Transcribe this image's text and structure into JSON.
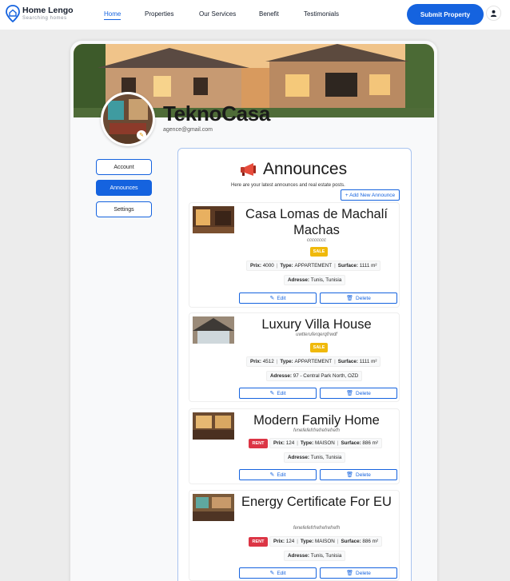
{
  "brand": {
    "name": "Home Lengo",
    "tagline": "Searching homes"
  },
  "nav": {
    "links": [
      {
        "label": "Home",
        "active": true
      },
      {
        "label": "Properties"
      },
      {
        "label": "Our Services"
      },
      {
        "label": "Benefit"
      },
      {
        "label": "Testimonials"
      }
    ],
    "submit_label": "Submit Property"
  },
  "profile": {
    "name": "TeknoCasa",
    "email": "agence@gmail.com"
  },
  "sidebar": {
    "items": [
      {
        "label": "Account"
      },
      {
        "label": "Announces",
        "active": true
      },
      {
        "label": "Settings"
      }
    ]
  },
  "announces": {
    "title": "Announces",
    "subtitle": "Here are your latest announces and real estate posts.",
    "add_label": "+ Add New Announce",
    "edit_label": "Edit",
    "delete_label": "Delete",
    "listings": [
      {
        "title": "Casa Lomas de Machalí Machas",
        "desc": "cccccccc",
        "badge": "SALE",
        "prix": "4000",
        "type": "APPARTEMENT",
        "surface": "1111 m²",
        "adresse": "Tunis, Tunisia"
      },
      {
        "title": "Luxury Villa House",
        "desc": "uwtteruferqerqfrwdf",
        "badge": "SALE",
        "prix": "4512",
        "type": "APPARTEMENT",
        "surface": "1111 m²",
        "adresse": "97 - Central Park North, OZD"
      },
      {
        "title": "Modern Family Home",
        "desc": "fvnefefefrfrefrefrefrefh",
        "badge": "RENT",
        "prix": "124",
        "type": "MAISON",
        "surface": "886 m²",
        "adresse": "Tunis, Tunisia"
      },
      {
        "title": "Energy Certificate For EU",
        "desc": "fenefefefrfrefrefrefrefh",
        "badge": "RENT",
        "prix": "124",
        "type": "MAISON",
        "surface": "886 m²",
        "adresse": "Tunis, Tunisia"
      }
    ]
  },
  "labels": {
    "prix": "Prix:",
    "type": "Type:",
    "surface": "Surface:",
    "adresse": "Adresse:"
  },
  "colors": {
    "accent": "#1563df",
    "sale": "#f0b90b",
    "rent": "#dc3545"
  }
}
